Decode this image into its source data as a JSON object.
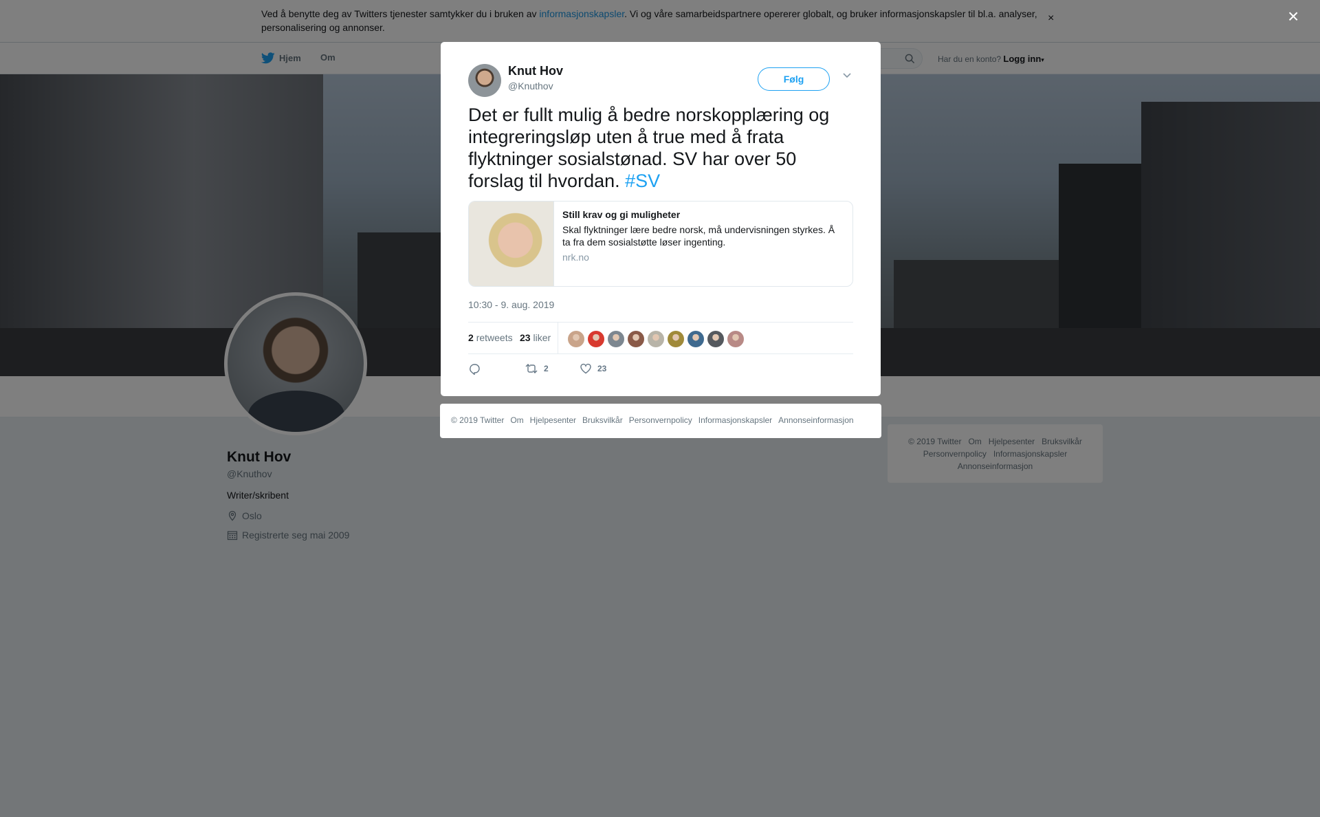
{
  "cookie_banner": {
    "text_before": "Ved å benytte deg av Twitters tjenester samtykker du i bruken av ",
    "link": "informasjonskapsler",
    "text_after": ". Vi og våre samarbeidspartnere opererer globalt, og bruker informasjonskapsler til bl.a. analyser, personalisering og annonser.",
    "close": "×"
  },
  "nav": {
    "home": "Hjem",
    "about": "Om",
    "account_prompt": "Har du en konto?",
    "login": "Logg inn"
  },
  "profile": {
    "name": "Knut Hov",
    "handle": "@Knuthov",
    "bio": "Writer/skribent",
    "location": "Oslo",
    "joined": "Registrerte seg mai 2009"
  },
  "right_footer": {
    "links": [
      "© 2019 Twitter",
      "Om",
      "Hjelpesenter",
      "Bruksvilkår",
      "Personvernpolicy",
      "Informasjonskapsler",
      "Annonseinformasjon"
    ]
  },
  "overlay": {
    "close": "×"
  },
  "tweet": {
    "author_name": "Knut Hov",
    "author_handle": "@Knuthov",
    "follow_label": "Følg",
    "text": "Det er fullt mulig å bedre norskopplæring og integreringsløp uten å true med å frata flyktninger sosialstønad. SV har over 50 forslag til hvordan. ",
    "hashtag": "#SV",
    "card": {
      "title": "Still krav og gi muligheter",
      "description": "Skal flyktninger lære bedre norsk, må undervisningen styrkes. Å ta fra dem sosialstøtte løser ingenting.",
      "domain": "nrk.no"
    },
    "timestamp": "10:30 - 9. aug. 2019",
    "retweets_count": "2",
    "retweets_label": "retweets",
    "likes_count": "23",
    "likes_label": "liker",
    "likers_colors": [
      "#c9a48a",
      "#d83a2f",
      "#7d8790",
      "#8a5a48",
      "#b8b4a8",
      "#a08a3a",
      "#3f6a8f",
      "#55595e",
      "#b88a86"
    ],
    "action_retweets": "2",
    "action_likes": "23"
  },
  "modal_footer": {
    "links": [
      "© 2019 Twitter",
      "Om",
      "Hjelpesenter",
      "Bruksvilkår",
      "Personvernpolicy",
      "Informasjonskapsler",
      "Annonseinformasjon"
    ]
  },
  "colors": {
    "brand": "#1da1f2",
    "link": "#1b95e0",
    "muted": "#66757f"
  }
}
